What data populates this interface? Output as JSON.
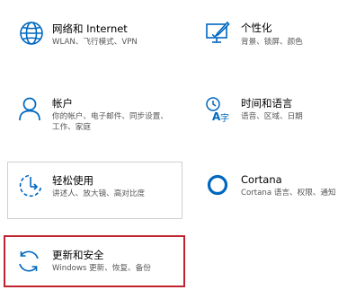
{
  "settings": {
    "network": {
      "title": "网络和 Internet",
      "desc": "WLAN、飞行模式、VPN",
      "icon": "globe-icon"
    },
    "personalization": {
      "title": "个性化",
      "desc": "背景、锁屏、颜色",
      "icon": "personalization-icon"
    },
    "accounts": {
      "title": "帐户",
      "desc": "你的帐户、电子邮件、同步设置、工作、家庭",
      "icon": "person-icon"
    },
    "time_language": {
      "title": "时间和语言",
      "desc": "语音、区域、日期",
      "icon": "time-language-icon"
    },
    "ease_of_access": {
      "title": "轻松使用",
      "desc": "讲述人、放大镜、高对比度",
      "icon": "ease-of-access-icon"
    },
    "cortana": {
      "title": "Cortana",
      "desc": "Cortana 语言、权限、通知",
      "icon": "cortana-icon"
    },
    "update_security": {
      "title": "更新和安全",
      "desc": "Windows 更新、恢复、备份",
      "icon": "update-sync-icon"
    }
  },
  "colors": {
    "accent": "#0067c0",
    "highlight_border": "#c0232f",
    "tile_border": "#cfcfcf",
    "desc_text": "#555555"
  }
}
